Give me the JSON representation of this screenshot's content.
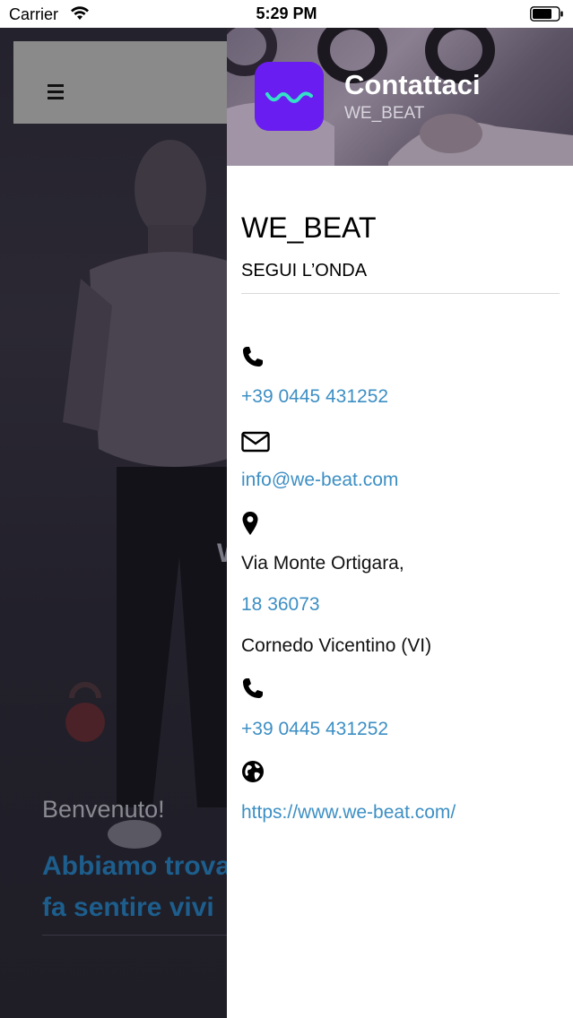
{
  "status_bar": {
    "carrier": "Carrier",
    "time": "5:29 PM"
  },
  "background_screen": {
    "partial_letter": "W",
    "welcome_text": "Benvenuto!",
    "headline_line1": "Abbiamo trova",
    "headline_line2": "fa sentire vivi"
  },
  "drawer": {
    "header": {
      "title": "Contattaci",
      "subtitle": "WE_BEAT"
    },
    "brand": {
      "name": "WE_BEAT",
      "tagline": "SEGUI L’ONDA"
    },
    "contacts": {
      "phone1": "+39 0445 431252",
      "email": "info@we-beat.com",
      "address_line1": "Via Monte Ortigara,",
      "address_line2": "18 36073",
      "address_line3": "Cornedo Vicentino (VI)",
      "phone2": "+39 0445 431252",
      "website": "https://www.we-beat.com/"
    }
  },
  "colors": {
    "link": "#3d8fc4",
    "app_icon_bg": "#6a1df0",
    "app_icon_wave": "#33e0c8",
    "headline_blue": "#1d5e8d"
  },
  "icons": [
    "wifi-icon",
    "battery-icon",
    "menu-icon",
    "phone-icon",
    "envelope-icon",
    "map-marker-icon",
    "globe-icon"
  ]
}
